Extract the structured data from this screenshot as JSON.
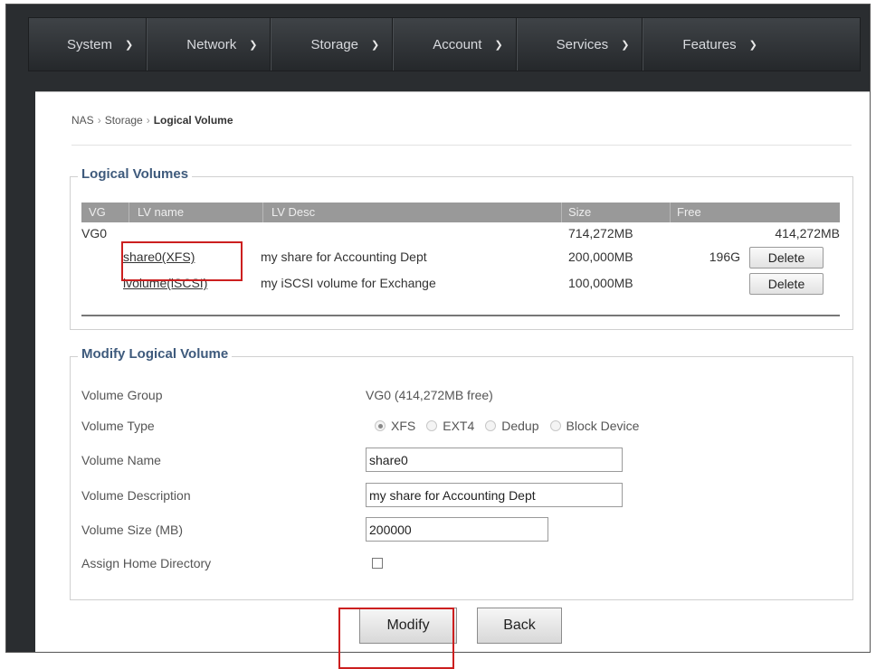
{
  "nav": {
    "items": [
      {
        "label": "System"
      },
      {
        "label": "Network"
      },
      {
        "label": "Storage"
      },
      {
        "label": "Account"
      },
      {
        "label": "Services"
      },
      {
        "label": "Features"
      }
    ],
    "chevron": "chevron-down-icon"
  },
  "breadcrumb": {
    "root": "NAS",
    "section": "Storage",
    "current": "Logical Volume",
    "separator": "›"
  },
  "logical_volumes": {
    "legend": "Logical Volumes",
    "columns": {
      "vg": "VG",
      "lv_name": "LV name",
      "lv_desc": "LV Desc",
      "size": "Size",
      "free": "Free"
    },
    "group": {
      "vg": "VG0",
      "size": "714,272MB",
      "free": "414,272MB"
    },
    "rows": [
      {
        "name": "share0(XFS)",
        "desc": "my share for Accounting Dept",
        "size": "200,000MB",
        "free": "196G",
        "delete_label": "Delete"
      },
      {
        "name": "ivolume(iSCSI)",
        "desc": "my iSCSI volume for Exchange",
        "size": "100,000MB",
        "free": "",
        "delete_label": "Delete"
      }
    ]
  },
  "modify": {
    "legend": "Modify Logical Volume",
    "volume_group_label": "Volume Group",
    "volume_group_value": "VG0 (414,272MB free)",
    "volume_type_label": "Volume Type",
    "volume_types": [
      "XFS",
      "EXT4",
      "Dedup",
      "Block Device"
    ],
    "volume_type_selected": "XFS",
    "volume_name_label": "Volume Name",
    "volume_name_value": "share0",
    "volume_desc_label": "Volume Description",
    "volume_desc_value": "my share for Accounting Dept",
    "volume_size_label": "Volume Size (MB)",
    "volume_size_value": "200000",
    "home_dir_label": "Assign Home Directory",
    "home_dir_checked": false
  },
  "actions": {
    "modify_label": "Modify",
    "back_label": "Back"
  },
  "colors": {
    "nav_bg": "#2f3235",
    "legend": "#3e5a7c",
    "table_header": "#999999",
    "highlight": "#cc1f1f"
  }
}
